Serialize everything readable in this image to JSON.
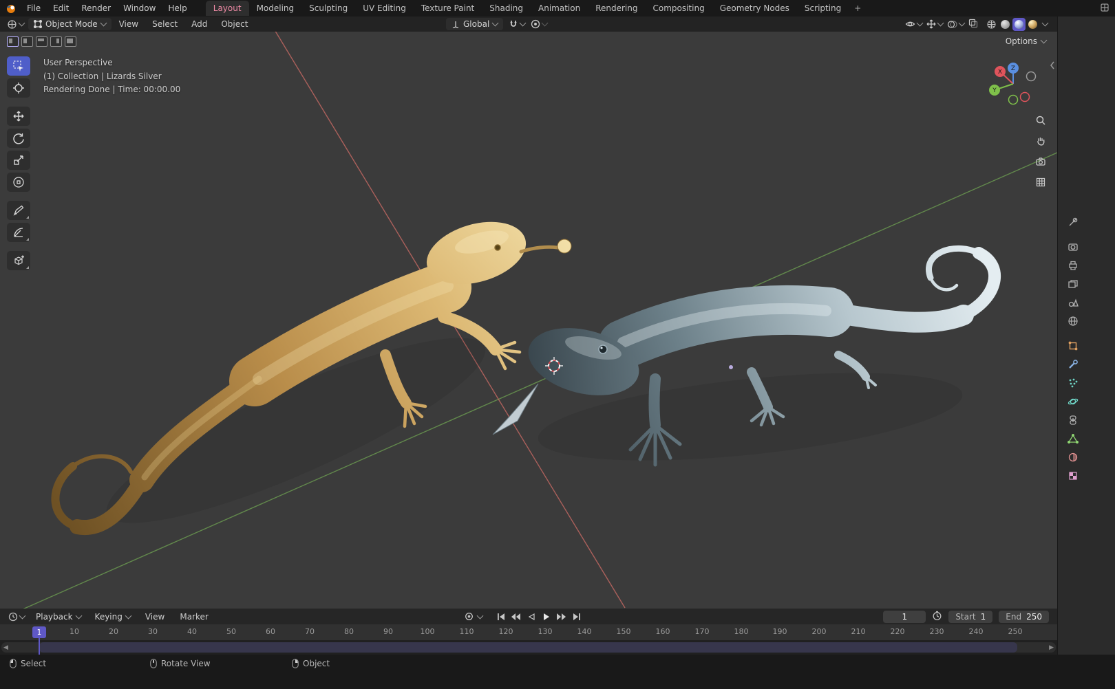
{
  "colors": {
    "accent": "#5f58c6",
    "active_tab_text": "#f08aa6",
    "tool_active": "#4f5ec9",
    "viewport_bg": "#3b3b3b",
    "gold_material": "#c9a05e",
    "silver_material": "#aebfc8",
    "axis_x": "#c86a64",
    "axis_y": "#6fa352"
  },
  "topbar": {
    "logo": "blender-logo",
    "menus": [
      "File",
      "Edit",
      "Render",
      "Window",
      "Help"
    ],
    "tabs": [
      "Layout",
      "Modeling",
      "Sculpting",
      "UV Editing",
      "Texture Paint",
      "Shading",
      "Animation",
      "Rendering",
      "Compositing",
      "Geometry Nodes",
      "Scripting"
    ],
    "active_tab": "Layout",
    "add_tab": "+"
  },
  "vheader": {
    "mode": "Object Mode",
    "menus": [
      "View",
      "Select",
      "Add",
      "Object"
    ],
    "orientation": "Global",
    "right_icons": [
      "visibility",
      "gizmos",
      "overlays",
      "xray",
      "shading-wireframe",
      "shading-solid",
      "shading-material",
      "shading-rendered"
    ],
    "active_shading": "shading-material"
  },
  "viewport": {
    "overlay_line1": "User Perspective",
    "overlay_line2": "(1) Collection | Lizards Silver",
    "overlay_line3": "Rendering Done | Time: 00:00.00",
    "options": "Options",
    "gizmo": {
      "x": "X",
      "y": "Y",
      "z": "Z"
    },
    "tools": [
      "select-box",
      "cursor",
      "move",
      "rotate",
      "scale",
      "transform",
      "annotate",
      "measure",
      "add-cube"
    ],
    "nav_icons": [
      "zoom",
      "pan",
      "camera-view",
      "toggle-ortho"
    ]
  },
  "sidebar": {
    "tabs": [
      "tool",
      "render",
      "output",
      "view-layer",
      "scene",
      "world",
      "object",
      "modifiers",
      "particles",
      "physics",
      "constraints",
      "object-data",
      "material",
      "texture"
    ]
  },
  "timeline": {
    "menus": [
      "Playback",
      "Keying",
      "View",
      "Marker"
    ],
    "playback_icons": [
      "auto-key",
      "jump-to-start",
      "previous-keyframe",
      "play-reverse",
      "play",
      "next-keyframe",
      "jump-to-end"
    ],
    "current_frame": "1",
    "playhead": "1",
    "start_label": "Start",
    "start_value": "1",
    "end_label": "End",
    "end_value": "250",
    "ticks": [
      "10",
      "20",
      "30",
      "40",
      "50",
      "60",
      "70",
      "80",
      "90",
      "100",
      "110",
      "120",
      "130",
      "140",
      "150",
      "160",
      "170",
      "180",
      "190",
      "200",
      "210",
      "220",
      "230",
      "240",
      "250"
    ]
  },
  "statusbar": {
    "hints": [
      {
        "mouse": "left-mouse-button",
        "label": "Select"
      },
      {
        "mouse": "middle-mouse-button",
        "label": "Rotate View"
      },
      {
        "mouse": "right-mouse-button",
        "label": "Object"
      }
    ]
  }
}
